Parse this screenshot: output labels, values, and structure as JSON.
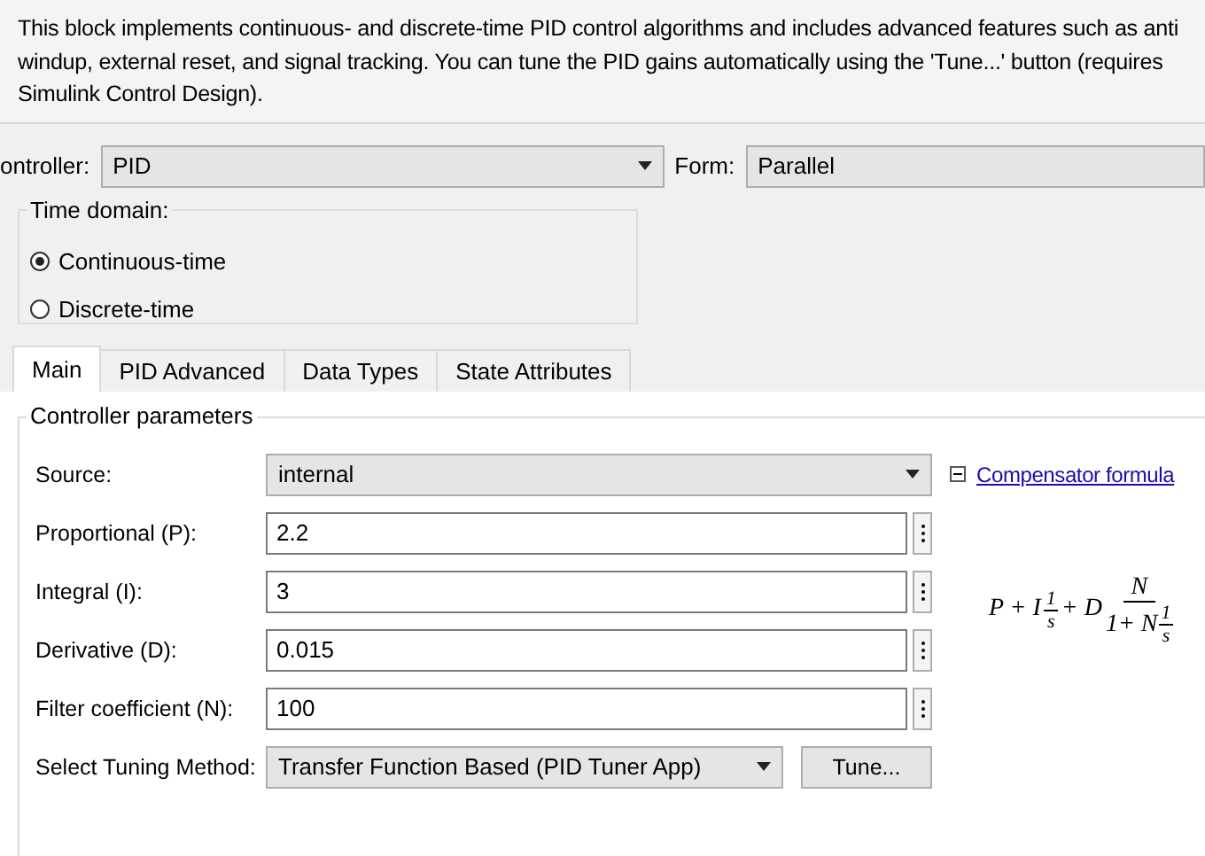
{
  "description": [
    "This block implements continuous- and discrete-time PID control algorithms and includes advanced features such as anti",
    "windup, external reset, and signal tracking. You can tune the PID gains automatically using the 'Tune...' button (requires",
    "Simulink Control Design)."
  ],
  "controller": {
    "label": "ontroller:",
    "value": "PID"
  },
  "form": {
    "label": "Form:",
    "value": "Parallel"
  },
  "time_domain": {
    "title": "Time domain:",
    "options": [
      {
        "label": "Continuous-time",
        "selected": true
      },
      {
        "label": "Discrete-time",
        "selected": false
      }
    ]
  },
  "tabs": [
    {
      "label": "Main",
      "selected": true
    },
    {
      "label": "PID Advanced",
      "selected": false
    },
    {
      "label": "Data Types",
      "selected": false
    },
    {
      "label": "State Attributes",
      "selected": false
    }
  ],
  "group_title": "Controller parameters",
  "params": [
    {
      "kind": "dropdown",
      "label": "Source:",
      "value": "internal"
    },
    {
      "kind": "field",
      "label": "Proportional (P):",
      "value": "2.2"
    },
    {
      "kind": "field",
      "label": "Integral (I):",
      "value": "3"
    },
    {
      "kind": "field",
      "label": "Derivative (D):",
      "value": "0.015"
    },
    {
      "kind": "field",
      "label": "Filter coefficient (N):",
      "value": "100"
    },
    {
      "kind": "tuning",
      "label": "Select Tuning Method:",
      "value": "Transfer Function Based (PID Tuner App)",
      "button": "Tune..."
    }
  ],
  "compensator": {
    "link": "Compensator formula",
    "expanded": true,
    "formula": {
      "lead": "P + I",
      "f1_num": "1",
      "f1_den": "s",
      "mid": "+ D",
      "f2_num": "N",
      "f2_den_lead": "1+ N",
      "f3_num": "1",
      "f3_den": "s"
    }
  }
}
